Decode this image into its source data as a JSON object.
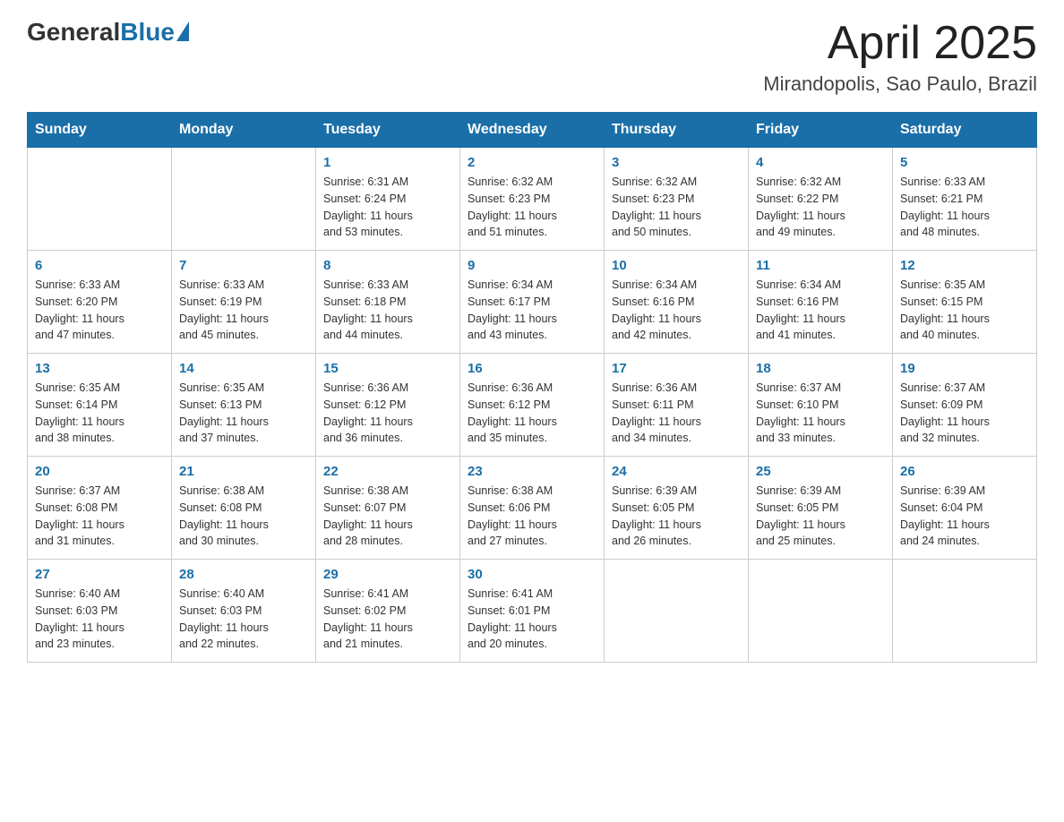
{
  "header": {
    "logo": {
      "general": "General",
      "blue": "Blue"
    },
    "title": "April 2025",
    "subtitle": "Mirandopolis, Sao Paulo, Brazil"
  },
  "days_of_week": [
    "Sunday",
    "Monday",
    "Tuesday",
    "Wednesday",
    "Thursday",
    "Friday",
    "Saturday"
  ],
  "weeks": [
    [
      {
        "day": "",
        "info": ""
      },
      {
        "day": "",
        "info": ""
      },
      {
        "day": "1",
        "info": "Sunrise: 6:31 AM\nSunset: 6:24 PM\nDaylight: 11 hours\nand 53 minutes."
      },
      {
        "day": "2",
        "info": "Sunrise: 6:32 AM\nSunset: 6:23 PM\nDaylight: 11 hours\nand 51 minutes."
      },
      {
        "day": "3",
        "info": "Sunrise: 6:32 AM\nSunset: 6:23 PM\nDaylight: 11 hours\nand 50 minutes."
      },
      {
        "day": "4",
        "info": "Sunrise: 6:32 AM\nSunset: 6:22 PM\nDaylight: 11 hours\nand 49 minutes."
      },
      {
        "day": "5",
        "info": "Sunrise: 6:33 AM\nSunset: 6:21 PM\nDaylight: 11 hours\nand 48 minutes."
      }
    ],
    [
      {
        "day": "6",
        "info": "Sunrise: 6:33 AM\nSunset: 6:20 PM\nDaylight: 11 hours\nand 47 minutes."
      },
      {
        "day": "7",
        "info": "Sunrise: 6:33 AM\nSunset: 6:19 PM\nDaylight: 11 hours\nand 45 minutes."
      },
      {
        "day": "8",
        "info": "Sunrise: 6:33 AM\nSunset: 6:18 PM\nDaylight: 11 hours\nand 44 minutes."
      },
      {
        "day": "9",
        "info": "Sunrise: 6:34 AM\nSunset: 6:17 PM\nDaylight: 11 hours\nand 43 minutes."
      },
      {
        "day": "10",
        "info": "Sunrise: 6:34 AM\nSunset: 6:16 PM\nDaylight: 11 hours\nand 42 minutes."
      },
      {
        "day": "11",
        "info": "Sunrise: 6:34 AM\nSunset: 6:16 PM\nDaylight: 11 hours\nand 41 minutes."
      },
      {
        "day": "12",
        "info": "Sunrise: 6:35 AM\nSunset: 6:15 PM\nDaylight: 11 hours\nand 40 minutes."
      }
    ],
    [
      {
        "day": "13",
        "info": "Sunrise: 6:35 AM\nSunset: 6:14 PM\nDaylight: 11 hours\nand 38 minutes."
      },
      {
        "day": "14",
        "info": "Sunrise: 6:35 AM\nSunset: 6:13 PM\nDaylight: 11 hours\nand 37 minutes."
      },
      {
        "day": "15",
        "info": "Sunrise: 6:36 AM\nSunset: 6:12 PM\nDaylight: 11 hours\nand 36 minutes."
      },
      {
        "day": "16",
        "info": "Sunrise: 6:36 AM\nSunset: 6:12 PM\nDaylight: 11 hours\nand 35 minutes."
      },
      {
        "day": "17",
        "info": "Sunrise: 6:36 AM\nSunset: 6:11 PM\nDaylight: 11 hours\nand 34 minutes."
      },
      {
        "day": "18",
        "info": "Sunrise: 6:37 AM\nSunset: 6:10 PM\nDaylight: 11 hours\nand 33 minutes."
      },
      {
        "day": "19",
        "info": "Sunrise: 6:37 AM\nSunset: 6:09 PM\nDaylight: 11 hours\nand 32 minutes."
      }
    ],
    [
      {
        "day": "20",
        "info": "Sunrise: 6:37 AM\nSunset: 6:08 PM\nDaylight: 11 hours\nand 31 minutes."
      },
      {
        "day": "21",
        "info": "Sunrise: 6:38 AM\nSunset: 6:08 PM\nDaylight: 11 hours\nand 30 minutes."
      },
      {
        "day": "22",
        "info": "Sunrise: 6:38 AM\nSunset: 6:07 PM\nDaylight: 11 hours\nand 28 minutes."
      },
      {
        "day": "23",
        "info": "Sunrise: 6:38 AM\nSunset: 6:06 PM\nDaylight: 11 hours\nand 27 minutes."
      },
      {
        "day": "24",
        "info": "Sunrise: 6:39 AM\nSunset: 6:05 PM\nDaylight: 11 hours\nand 26 minutes."
      },
      {
        "day": "25",
        "info": "Sunrise: 6:39 AM\nSunset: 6:05 PM\nDaylight: 11 hours\nand 25 minutes."
      },
      {
        "day": "26",
        "info": "Sunrise: 6:39 AM\nSunset: 6:04 PM\nDaylight: 11 hours\nand 24 minutes."
      }
    ],
    [
      {
        "day": "27",
        "info": "Sunrise: 6:40 AM\nSunset: 6:03 PM\nDaylight: 11 hours\nand 23 minutes."
      },
      {
        "day": "28",
        "info": "Sunrise: 6:40 AM\nSunset: 6:03 PM\nDaylight: 11 hours\nand 22 minutes."
      },
      {
        "day": "29",
        "info": "Sunrise: 6:41 AM\nSunset: 6:02 PM\nDaylight: 11 hours\nand 21 minutes."
      },
      {
        "day": "30",
        "info": "Sunrise: 6:41 AM\nSunset: 6:01 PM\nDaylight: 11 hours\nand 20 minutes."
      },
      {
        "day": "",
        "info": ""
      },
      {
        "day": "",
        "info": ""
      },
      {
        "day": "",
        "info": ""
      }
    ]
  ]
}
